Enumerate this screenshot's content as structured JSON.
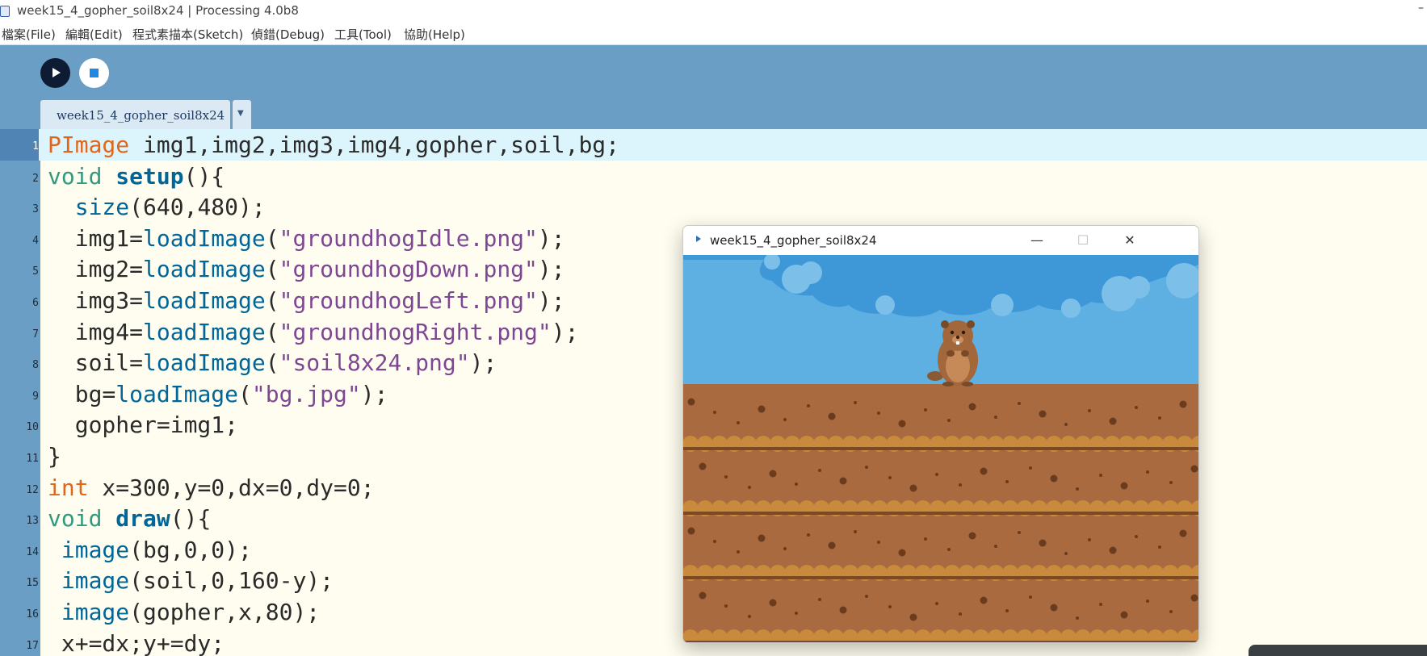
{
  "window": {
    "title": "week15_4_gopher_soil8x24 | Processing 4.0b8",
    "minimize_glyph": "–"
  },
  "menu": {
    "items": [
      "檔案(File)",
      "編輯(Edit)",
      "程式素描本(Sketch)",
      "偵錯(Debug)",
      "工具(Tool)",
      "協助(Help)"
    ]
  },
  "toolbar": {
    "run_icon": "play-icon",
    "stop_icon": "stop-icon"
  },
  "tab": {
    "label": "week15_4_gopher_soil8x24",
    "menu_arrow": "▼"
  },
  "editor": {
    "current_line": 1,
    "lines": [
      {
        "n": "1",
        "code": "PImage img1,img2,img3,img4,gopher,soil,bg;"
      },
      {
        "n": "2",
        "code": "void setup(){"
      },
      {
        "n": "3",
        "code": "  size(640,480);"
      },
      {
        "n": "4",
        "code": "  img1=loadImage(\"groundhogIdle.png\");"
      },
      {
        "n": "5",
        "code": "  img2=loadImage(\"groundhogDown.png\");"
      },
      {
        "n": "6",
        "code": "  img3=loadImage(\"groundhogLeft.png\");"
      },
      {
        "n": "7",
        "code": "  img4=loadImage(\"groundhogRight.png\");"
      },
      {
        "n": "8",
        "code": "  soil=loadImage(\"soil8x24.png\");"
      },
      {
        "n": "9",
        "code": "  bg=loadImage(\"bg.jpg\");"
      },
      {
        "n": "10",
        "code": "  gopher=img1;"
      },
      {
        "n": "11",
        "code": "}"
      },
      {
        "n": "12",
        "code": "int x=300,y=0,dx=0,dy=0;"
      },
      {
        "n": "13",
        "code": "void draw(){"
      },
      {
        "n": "14",
        "code": " image(bg,0,0);"
      },
      {
        "n": "15",
        "code": " image(soil,0,160-y);"
      },
      {
        "n": "16",
        "code": " image(gopher,x,80);"
      },
      {
        "n": "17",
        "code": " x+=dx;y+=dy;"
      }
    ]
  },
  "sketch_window": {
    "title": "week15_4_gopher_soil8x24",
    "minimize": "—",
    "maximize": "☐",
    "close": "✕"
  },
  "colors": {
    "toolbar_bg": "#6b9ec5",
    "editor_bg": "#fffdef",
    "current_line_bg": "#dcf4fb",
    "type_keyword": "#e2661a",
    "void_keyword": "#33997e",
    "function": "#006699",
    "string": "#7d4793",
    "sky": "#5fb0e2",
    "soil": "#a86a3e"
  }
}
